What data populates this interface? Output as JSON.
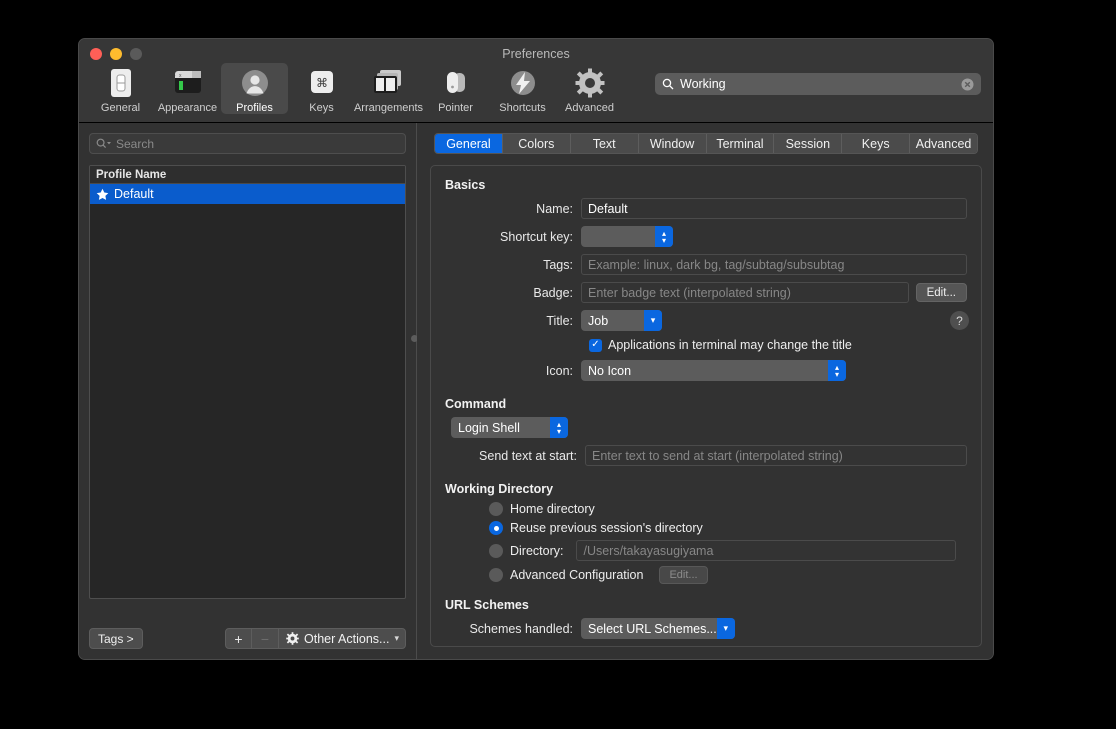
{
  "window": {
    "title": "Preferences",
    "traffic_lights": [
      "close",
      "minimize",
      "zoom"
    ]
  },
  "toolbar": {
    "items": [
      {
        "label": "General",
        "icon": "general-icon"
      },
      {
        "label": "Appearance",
        "icon": "appearance-icon"
      },
      {
        "label": "Profiles",
        "icon": "profiles-icon"
      },
      {
        "label": "Keys",
        "icon": "keys-icon"
      },
      {
        "label": "Arrangements",
        "icon": "arrangements-icon"
      },
      {
        "label": "Pointer",
        "icon": "pointer-icon"
      },
      {
        "label": "Shortcuts",
        "icon": "shortcuts-icon"
      },
      {
        "label": "Advanced",
        "icon": "advanced-icon"
      }
    ],
    "selected": "Profiles",
    "search": {
      "value": "Working",
      "placeholder": "Search"
    }
  },
  "sidebar": {
    "search_placeholder": "Search",
    "table": {
      "column_header": "Profile Name",
      "rows": [
        {
          "name": "Default",
          "starred": true,
          "selected": true
        }
      ]
    },
    "bottom": {
      "tags_label": "Tags >",
      "add_label": "+",
      "remove_label": "−",
      "other_actions_label": "Other Actions..."
    }
  },
  "tabs": {
    "items": [
      "General",
      "Colors",
      "Text",
      "Window",
      "Terminal",
      "Session",
      "Keys",
      "Advanced"
    ],
    "active": "General"
  },
  "basics": {
    "title": "Basics",
    "name_label": "Name:",
    "name_value": "Default",
    "shortcut_label": "Shortcut key:",
    "shortcut_value": "",
    "tags_label": "Tags:",
    "tags_placeholder": "Example: linux, dark bg, tag/subtag/subsubtag",
    "badge_label": "Badge:",
    "badge_placeholder": "Enter badge text (interpolated string)",
    "badge_edit_label": "Edit...",
    "title_label": "Title:",
    "title_value": "Job",
    "checkbox_label": "Applications in terminal may change the title",
    "checkbox_checked": true,
    "icon_label": "Icon:",
    "icon_value": "No Icon",
    "help_label": "?"
  },
  "command": {
    "title": "Command",
    "shell_value": "Login Shell",
    "send_text_label": "Send text at start:",
    "send_text_placeholder": "Enter text to send at start (interpolated string)"
  },
  "working_directory": {
    "title": "Working Directory",
    "options": [
      {
        "label": "Home directory",
        "selected": false
      },
      {
        "label": "Reuse previous session's directory",
        "selected": true
      },
      {
        "label": "Directory:",
        "selected": false,
        "value": "/Users/takayasugiyama"
      },
      {
        "label": "Advanced Configuration",
        "selected": false,
        "button": "Edit..."
      }
    ]
  },
  "url_schemes": {
    "title": "URL Schemes",
    "label": "Schemes handled:",
    "value": "Select URL Schemes..."
  },
  "colors": {
    "accent": "#0a67e0",
    "selection": "#0a5ccc",
    "window_bg": "#323232",
    "titlebar_bg": "#373737"
  }
}
